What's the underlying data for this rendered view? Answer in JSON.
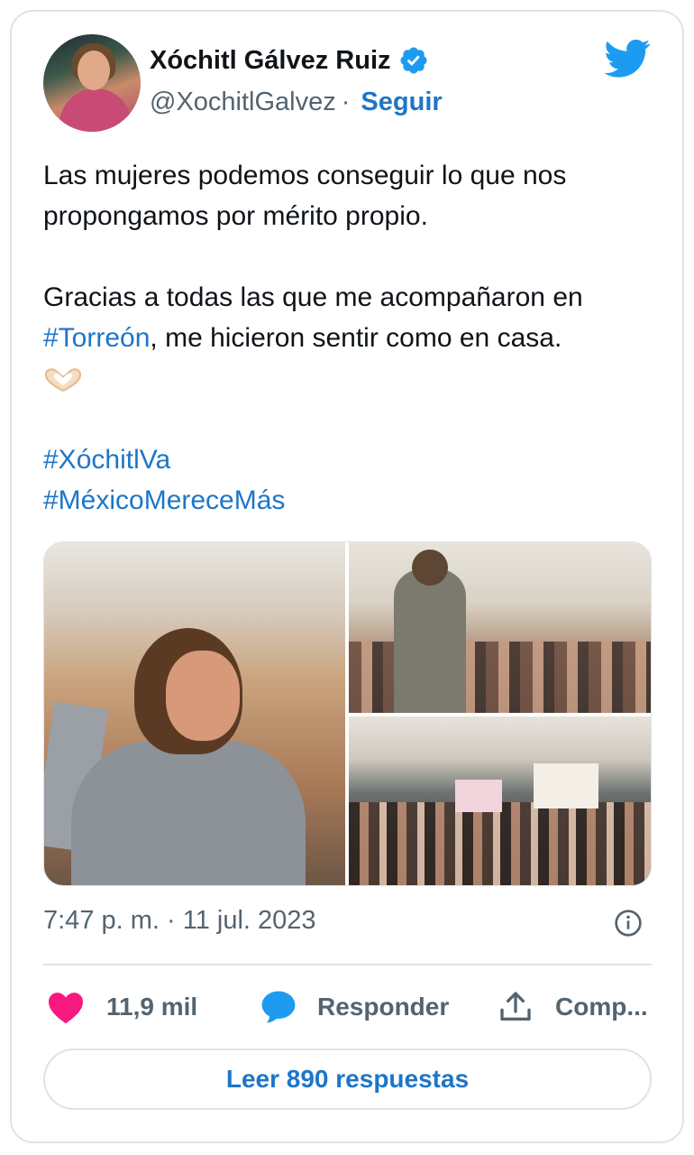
{
  "author": {
    "name": "Xóchitl Gálvez Ruiz",
    "handle": "@XochitlGalvez",
    "separator": "·",
    "follow_label": "Seguir",
    "verified": true
  },
  "tweet": {
    "line1": "Las mujeres podemos conseguir lo que nos",
    "line2": "propongamos por mérito propio.",
    "line3_pre": "Gracias a todas las que me acompañaron en",
    "line4_hashtag": "#Torreón",
    "line4_post": ", me hicieron sentir como en casa.",
    "emoji": "heart-hands",
    "hashtag1": "#XóchitlVa",
    "hashtag2": "#MéxicoMereceMás"
  },
  "media": {
    "photos": [
      "photo-1",
      "photo-2",
      "photo-3"
    ]
  },
  "meta": {
    "timestamp": "7:47 p. m. · 11 jul. 2023"
  },
  "actions": {
    "likes": "11,9 mil",
    "reply_label": "Responder",
    "share_label": "Comp..."
  },
  "read_replies": "Leer 890 respuestas",
  "colors": {
    "accent": "#1d76c8",
    "muted": "#536471",
    "like": "#f91880",
    "twitter_blue": "#1d9bf0",
    "border": "#dfe3e6"
  }
}
